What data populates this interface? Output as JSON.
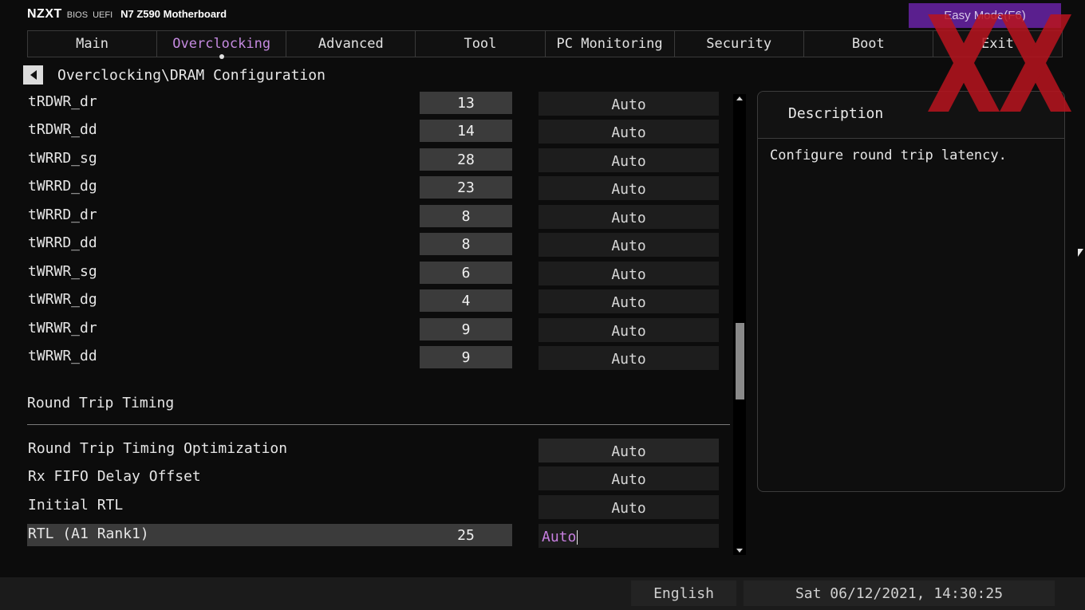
{
  "brand": {
    "logo": "NZXT",
    "bios": "BIOS",
    "uefi": "UEFI",
    "model": "N7 Z590 Motherboard"
  },
  "easy_mode_label": "Easy Mode(F6)",
  "tabs": [
    {
      "label": "Main"
    },
    {
      "label": "Overclocking"
    },
    {
      "label": "Advanced"
    },
    {
      "label": "Tool"
    },
    {
      "label": "PC Monitoring"
    },
    {
      "label": "Security"
    },
    {
      "label": "Boot"
    },
    {
      "label": "Exit"
    }
  ],
  "active_tab": "Overclocking",
  "accent_color": "#c58ae0",
  "breadcrumb": "Overclocking\\DRAM Configuration",
  "timings": [
    {
      "label": "tRDWR_dr",
      "current": "13",
      "option": "Auto"
    },
    {
      "label": "tRDWR_dd",
      "current": "14",
      "option": "Auto"
    },
    {
      "label": "tWRRD_sg",
      "current": "28",
      "option": "Auto"
    },
    {
      "label": "tWRRD_dg",
      "current": "23",
      "option": "Auto"
    },
    {
      "label": "tWRRD_dr",
      "current": "8",
      "option": "Auto"
    },
    {
      "label": "tWRRD_dd",
      "current": "8",
      "option": "Auto"
    },
    {
      "label": "tWRWR_sg",
      "current": "6",
      "option": "Auto"
    },
    {
      "label": "tWRWR_dg",
      "current": "4",
      "option": "Auto"
    },
    {
      "label": "tWRWR_dr",
      "current": "9",
      "option": "Auto"
    },
    {
      "label": "tWRWR_dd",
      "current": "9",
      "option": "Auto"
    }
  ],
  "section_title": "Round Trip Timing",
  "round_trip": [
    {
      "label": "Round Trip Timing Optimization",
      "current": "",
      "option": "Auto"
    },
    {
      "label": "Rx FIFO Delay Offset",
      "current": "",
      "option": "Auto"
    },
    {
      "label": "Initial RTL",
      "current": "",
      "option": "Auto"
    },
    {
      "label": "RTL (A1 Rank1)",
      "current": "25",
      "option": "Auto"
    }
  ],
  "description": {
    "title": "Description",
    "text": "Configure round trip latency."
  },
  "footer": {
    "language": "English",
    "datetime": "Sat 06/12/2021, 14:30:25"
  }
}
